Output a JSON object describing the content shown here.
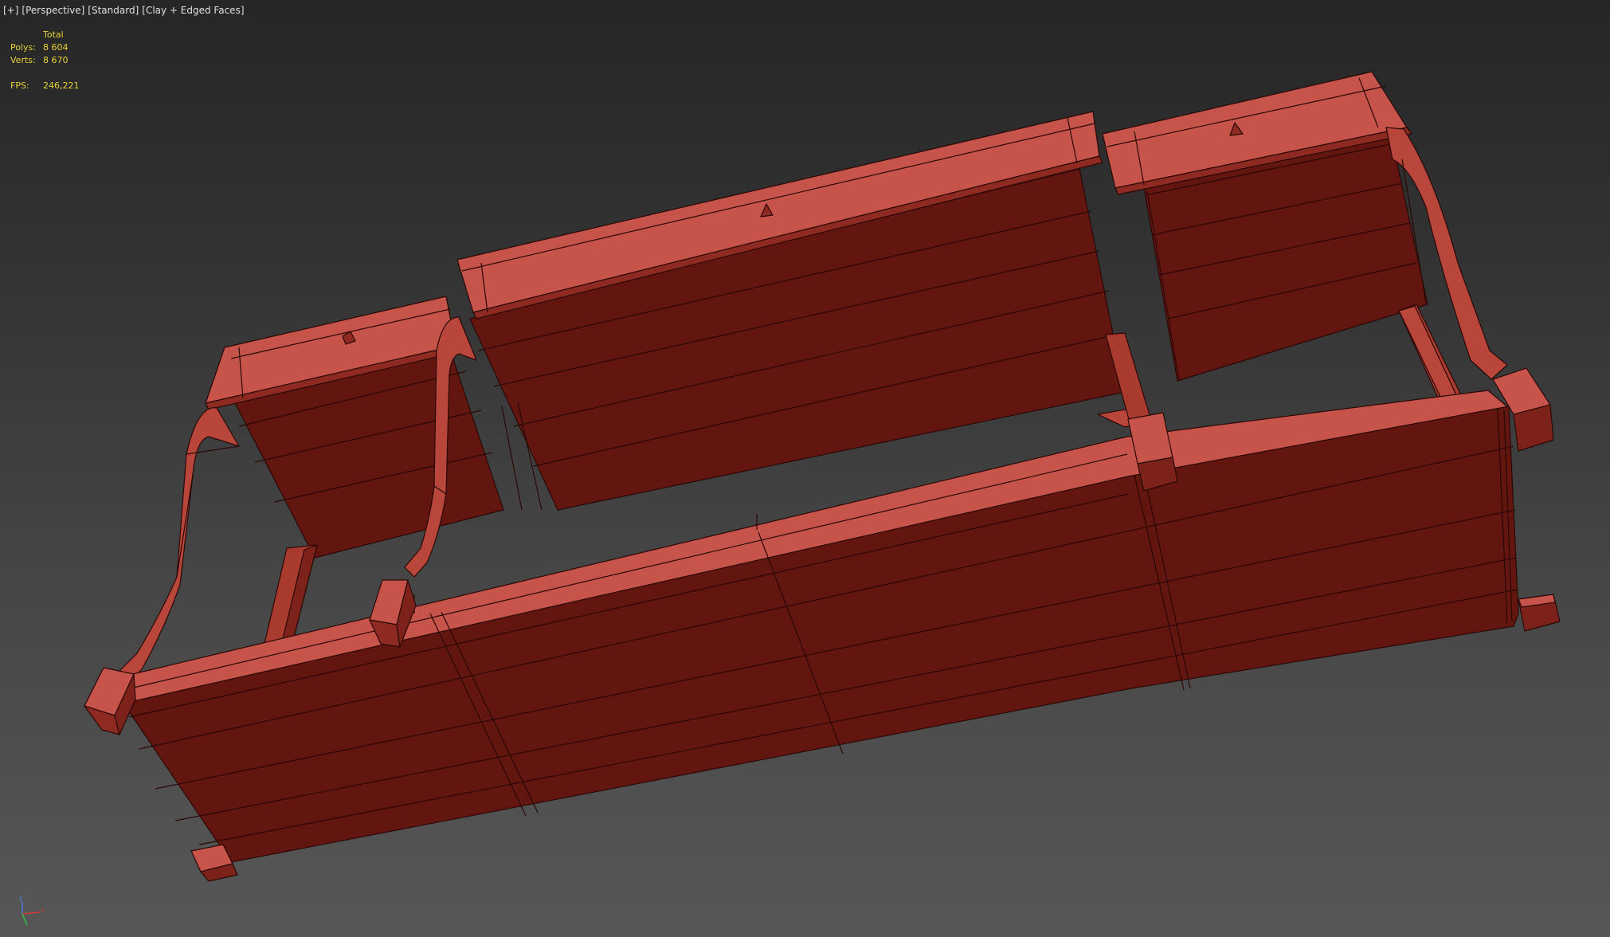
{
  "viewport": {
    "label_parts": [
      "[+]",
      "[Perspective]",
      "[Standard]",
      "[Clay + Edged Faces]"
    ],
    "background_top": "#262626",
    "background_bottom": "#575757"
  },
  "stats": {
    "header": "Total",
    "polys_label": "Polys:",
    "polys_value": "8 604",
    "verts_label": "Verts:",
    "verts_value": "8 670",
    "fps_label": "FPS:",
    "fps_value": "246,221",
    "color": "#e8d23a"
  },
  "model": {
    "name": "sofa-frame",
    "base_color": "#a83a2e",
    "shade_color": "#631510",
    "top_color": "#c6544a",
    "edge_color": "#2a0806"
  },
  "gizmo": {
    "axes": [
      "x-axis",
      "y-axis",
      "z-axis"
    ],
    "x_color": "#d03a3a",
    "y_color": "#3ac03a",
    "z_color": "#4a7ad8"
  }
}
